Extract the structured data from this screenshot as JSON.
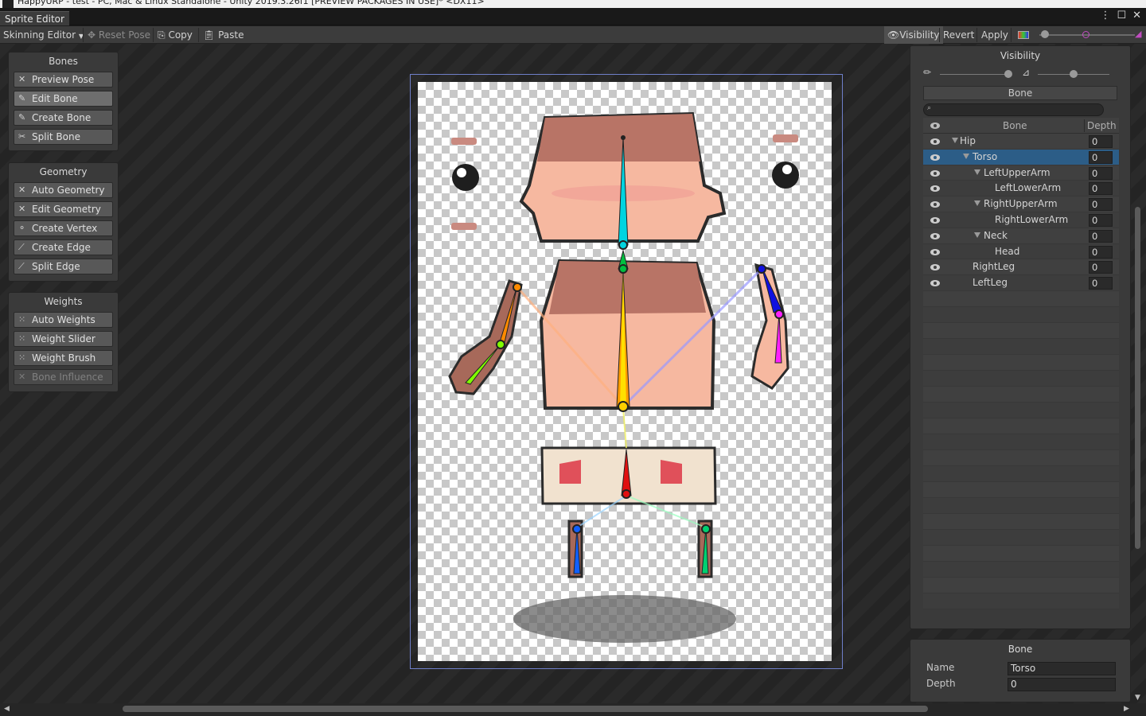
{
  "os": {
    "title": "HappyURP - test - PC, Mac & Linux Standalone - Unity 2019.3.26f1 [PREVIEW PACKAGES IN USE]* <DX11>"
  },
  "window": {
    "tab": "Sprite Editor"
  },
  "toolbar": {
    "mode_dropdown": "Skinning Editor",
    "reset_pose": "Reset Pose",
    "copy": "Copy",
    "paste": "Paste",
    "visibility": "Visibility",
    "revert": "Revert",
    "apply": "Apply"
  },
  "bones_panel": {
    "title": "Bones",
    "buttons": [
      "Preview Pose",
      "Edit Bone",
      "Create Bone",
      "Split Bone"
    ]
  },
  "geometry_panel": {
    "title": "Geometry",
    "buttons": [
      "Auto Geometry",
      "Edit Geometry",
      "Create Vertex",
      "Create Edge",
      "Split Edge"
    ]
  },
  "weights_panel": {
    "title": "Weights",
    "buttons": [
      "Auto Weights",
      "Weight Slider",
      "Weight Brush",
      "Bone Influence"
    ]
  },
  "visibility_panel": {
    "title": "Visibility",
    "tab": "Bone",
    "col_bone": "Bone",
    "col_depth": "Depth",
    "rows": [
      {
        "name": "Hip",
        "depth": "0"
      },
      {
        "name": "Torso",
        "depth": "0"
      },
      {
        "name": "LeftUpperArm",
        "depth": "0"
      },
      {
        "name": "LeftLowerArm",
        "depth": "0"
      },
      {
        "name": "RightUpperArm",
        "depth": "0"
      },
      {
        "name": "RightLowerArm",
        "depth": "0"
      },
      {
        "name": "Neck",
        "depth": "0"
      },
      {
        "name": "Head",
        "depth": "0"
      },
      {
        "name": "RightLeg",
        "depth": "0"
      },
      {
        "name": "LeftLeg",
        "depth": "0"
      }
    ]
  },
  "bone_properties": {
    "title": "Bone",
    "name_label": "Name",
    "name_value": "Torso",
    "depth_label": "Depth",
    "depth_value": "0"
  },
  "colors": {
    "selection": "#2c5d87",
    "canvas_frame": "#6f7fc9",
    "bone_head": "#00d4e0",
    "bone_torso": "#ff9a00",
    "bone_hip": "#e01010"
  }
}
